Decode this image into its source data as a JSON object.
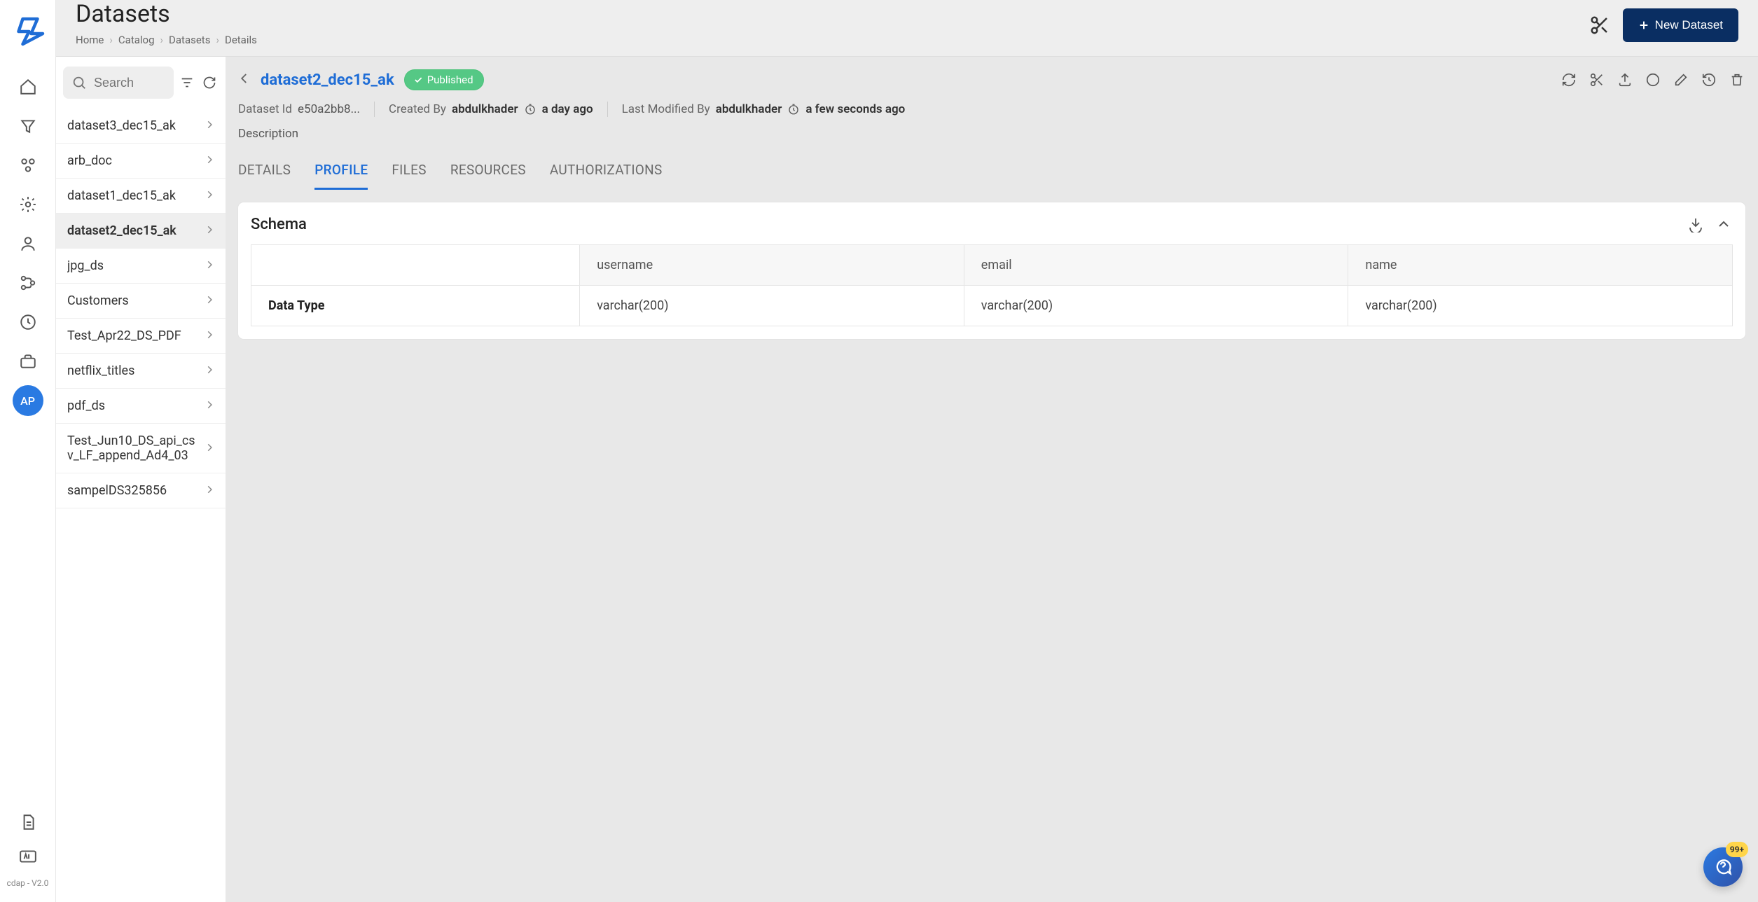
{
  "header": {
    "title": "Datasets",
    "breadcrumbs": [
      "Home",
      "Catalog",
      "Datasets",
      "Details"
    ],
    "new_button": "New Dataset"
  },
  "nav_rail": {
    "avatar": "AP",
    "version": "cdap - V2.0"
  },
  "sidebar": {
    "search_placeholder": "Search",
    "items": [
      {
        "label": "dataset3_dec15_ak",
        "active": false
      },
      {
        "label": "arb_doc",
        "active": false
      },
      {
        "label": "dataset1_dec15_ak",
        "active": false
      },
      {
        "label": "dataset2_dec15_ak",
        "active": true
      },
      {
        "label": "jpg_ds",
        "active": false
      },
      {
        "label": "Customers",
        "active": false
      },
      {
        "label": "Test_Apr22_DS_PDF",
        "active": false
      },
      {
        "label": "netflix_titles",
        "active": false
      },
      {
        "label": "pdf_ds",
        "active": false
      },
      {
        "label": "Test_Jun10_DS_api_csv_LF_append_Ad4_03",
        "active": false
      },
      {
        "label": "sampelDS325856",
        "active": false
      }
    ]
  },
  "dataset": {
    "name": "dataset2_dec15_ak",
    "status": "Published",
    "id_label": "Dataset Id",
    "id_value": "e50a2bb8...",
    "created_by_label": "Created By",
    "created_by_user": "abdulkhader",
    "created_by_time": "a day ago",
    "modified_by_label": "Last Modified By",
    "modified_by_user": "abdulkhader",
    "modified_by_time": "a few seconds ago",
    "description_label": "Description",
    "tabs": [
      "DETAILS",
      "PROFILE",
      "FILES",
      "RESOURCES",
      "AUTHORIZATIONS"
    ],
    "active_tab": "PROFILE"
  },
  "schema": {
    "title": "Schema",
    "row_header": "Data Type",
    "columns": [
      "username",
      "email",
      "name"
    ],
    "values": [
      "varchar(200)",
      "varchar(200)",
      "varchar(200)"
    ]
  },
  "help": {
    "badge": "99+"
  }
}
